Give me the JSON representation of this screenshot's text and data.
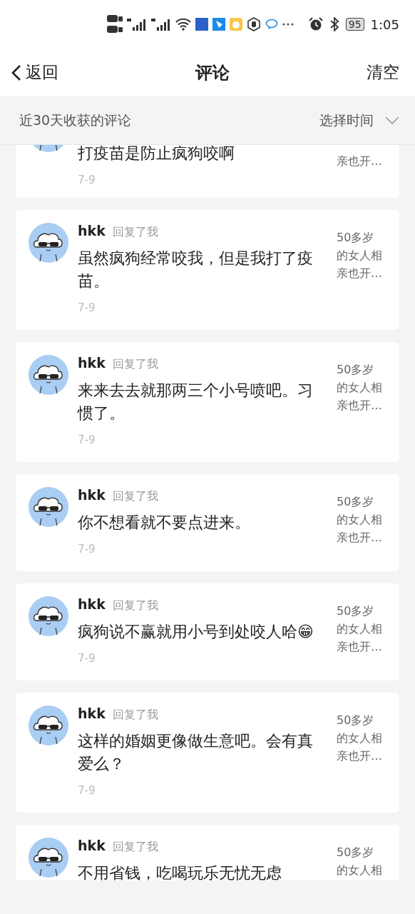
{
  "status_bar": {
    "time": "1:05",
    "battery": "95"
  },
  "header": {
    "back": "返回",
    "title": "评论",
    "action": "清空"
  },
  "filter": {
    "label": "近30天收获的评论",
    "picker": "选择时间"
  },
  "comments": [
    {
      "kind": "partial",
      "text": "打疫苗是防止疯狗咬啊",
      "date": "7-9",
      "post": "亲也开…"
    },
    {
      "kind": "full",
      "user": "hkk",
      "action": "回复了我",
      "text": "虽然疯狗经常咬我，但是我打了疫苗。",
      "date": "7-9",
      "post": "50多岁的女人相亲也开…"
    },
    {
      "kind": "full",
      "user": "hkk",
      "action": "回复了我",
      "text": "来来去去就那两三个小号喷吧。习惯了。",
      "date": "7-9",
      "post": "50多岁的女人相亲也开…"
    },
    {
      "kind": "full",
      "user": "hkk",
      "action": "回复了我",
      "text": "你不想看就不要点进来。",
      "date": "7-9",
      "post": "50多岁的女人相亲也开…"
    },
    {
      "kind": "full",
      "user": "hkk",
      "action": "回复了我",
      "text": "疯狗说不赢就用小号到处咬人哈😁",
      "date": "7-9",
      "post": "50多岁的女人相亲也开…"
    },
    {
      "kind": "full",
      "user": "hkk",
      "action": "回复了我",
      "text": "这样的婚姻更像做生意吧。会有真爱么？",
      "date": "7-9",
      "post": "50多岁的女人相亲也开…"
    },
    {
      "kind": "cut",
      "user": "hkk",
      "action": "回复了我",
      "text": "不用省钱，吃喝玩乐无忧无虑",
      "post": "50多岁的女人相"
    }
  ]
}
